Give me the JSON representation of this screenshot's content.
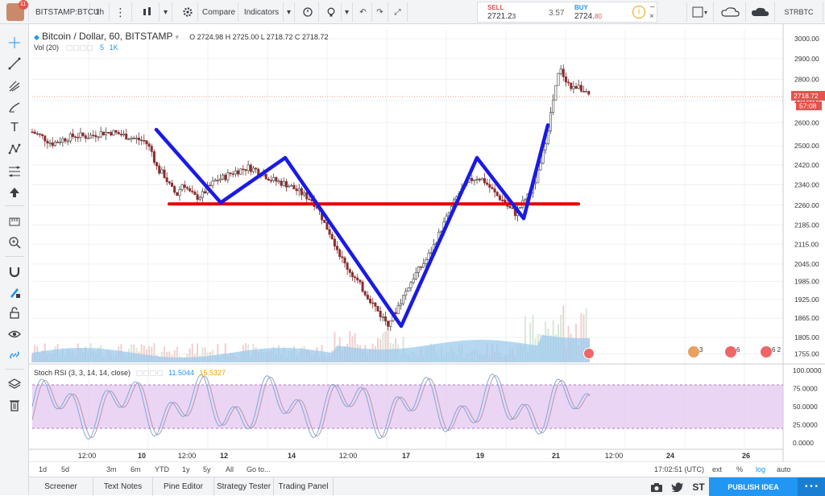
{
  "toolbar": {
    "symbol": "BITSTAMP:BTCU",
    "interval": "1h",
    "compare": "Compare",
    "indicators": "Indicators",
    "sell_label": "SELL",
    "sell_price_main": "2721.2",
    "sell_price_small": "3",
    "spread": "3.57",
    "buy_label": "BUY",
    "buy_price_main": "2724.",
    "buy_price_small": "80",
    "layout_name": "STRBTC"
  },
  "legend": {
    "title": "Bitcoin / Dollar, 60, BITSTAMP",
    "ohlc": "O 2724.98  H 2725.00  L 2718.72  C 2718.72",
    "vol_label": "Vol (20)",
    "vol_value_a": "5",
    "vol_value_b": "1K",
    "rsi_label": "Stoch RSI (3, 3, 14, 14, close)",
    "rsi_k": "11.5044",
    "rsi_d": "15.5327"
  },
  "price_axis": {
    "ticks": [
      "3000.00",
      "2900.00",
      "2800.00",
      "2700.00",
      "2600.00",
      "2500.00",
      "2420.00",
      "2340.00",
      "2260.00",
      "2185.00",
      "2115.00",
      "2045.00",
      "1985.00",
      "1925.00",
      "1865.00",
      "1805.00",
      "1755.00"
    ],
    "last_price": "2718.72",
    "countdown": "57:08"
  },
  "rsi_axis": {
    "ticks": [
      "100.0000",
      "75.0000",
      "50.0000",
      "25.0000",
      "0.0000"
    ]
  },
  "time_axis": {
    "ticks": [
      "12:00",
      "10",
      "12:00",
      "12",
      "14",
      "12:00",
      "17",
      "19",
      "21",
      "12:00",
      "24",
      "26"
    ]
  },
  "range_bar": {
    "buttons": [
      "1d",
      "5d",
      "3m",
      "6m",
      "YTD",
      "1y",
      "5y",
      "All",
      "Go to..."
    ],
    "clock": "17:02:51 (UTC)",
    "options": [
      "ext",
      "%",
      "log",
      "auto"
    ]
  },
  "flags": [
    "3",
    "6",
    "6 2"
  ],
  "bottom_tabs": [
    "Screener",
    "Text Notes",
    "Pine Editor",
    "Strategy Tester",
    "Trading Panel"
  ],
  "bottom_right": {
    "st": "ST",
    "publish": "PUBLISH IDEA"
  },
  "chart_data": {
    "type": "candlestick",
    "title": "Bitcoin / Dollar, 60, BITSTAMP",
    "y_axis_scale": "log",
    "ylim": [
      1730,
      3050
    ],
    "close_path": [
      [
        0,
        2560
      ],
      [
        12,
        2540
      ],
      [
        25,
        2510
      ],
      [
        40,
        2530
      ],
      [
        55,
        2545
      ],
      [
        70,
        2540
      ],
      [
        85,
        2555
      ],
      [
        100,
        2560
      ],
      [
        115,
        2545
      ],
      [
        130,
        2530
      ],
      [
        142,
        2520
      ],
      [
        150,
        2480
      ],
      [
        158,
        2400
      ],
      [
        166,
        2380
      ],
      [
        174,
        2330
      ],
      [
        182,
        2300
      ],
      [
        190,
        2350
      ],
      [
        198,
        2310
      ],
      [
        206,
        2290
      ],
      [
        214,
        2300
      ],
      [
        222,
        2330
      ],
      [
        232,
        2360
      ],
      [
        242,
        2370
      ],
      [
        252,
        2390
      ],
      [
        262,
        2400
      ],
      [
        272,
        2410
      ],
      [
        282,
        2400
      ],
      [
        292,
        2380
      ],
      [
        302,
        2360
      ],
      [
        312,
        2350
      ],
      [
        322,
        2340
      ],
      [
        332,
        2320
      ],
      [
        342,
        2300
      ],
      [
        352,
        2280
      ],
      [
        360,
        2250
      ],
      [
        368,
        2190
      ],
      [
        376,
        2150
      ],
      [
        384,
        2100
      ],
      [
        392,
        2050
      ],
      [
        400,
        2020
      ],
      [
        408,
        1990
      ],
      [
        416,
        1960
      ],
      [
        424,
        1930
      ],
      [
        432,
        1900
      ],
      [
        440,
        1870
      ],
      [
        448,
        1850
      ],
      [
        456,
        1880
      ],
      [
        464,
        1920
      ],
      [
        472,
        1960
      ],
      [
        480,
        2000
      ],
      [
        488,
        2030
      ],
      [
        496,
        2060
      ],
      [
        504,
        2100
      ],
      [
        512,
        2150
      ],
      [
        520,
        2200
      ],
      [
        528,
        2250
      ],
      [
        536,
        2300
      ],
      [
        544,
        2330
      ],
      [
        552,
        2360
      ],
      [
        560,
        2370
      ],
      [
        568,
        2360
      ],
      [
        576,
        2330
      ],
      [
        584,
        2300
      ],
      [
        592,
        2280
      ],
      [
        600,
        2250
      ],
      [
        608,
        2230
      ],
      [
        616,
        2260
      ],
      [
        624,
        2300
      ],
      [
        632,
        2340
      ],
      [
        640,
        2420
      ],
      [
        648,
        2550
      ],
      [
        656,
        2700
      ],
      [
        664,
        2850
      ],
      [
        672,
        2800
      ],
      [
        680,
        2750
      ],
      [
        688,
        2780
      ],
      [
        696,
        2730
      ],
      [
        702,
        2719
      ]
    ],
    "annotations": [
      {
        "type": "horizontal-line",
        "color": "#e60000",
        "value": 2265,
        "x_range": [
          174,
          682
        ]
      },
      {
        "type": "polyline",
        "color": "#1a1ae6",
        "points": [
          [
            158,
            2570
          ],
          [
            238,
            2270
          ],
          [
            318,
            2450
          ],
          [
            462,
            1840
          ],
          [
            556,
            2450
          ],
          [
            614,
            2210
          ],
          [
            644,
            2590
          ]
        ]
      }
    ]
  },
  "colors": {
    "up_candle": "#3d3d3d",
    "down_candle": "#8a2e2e",
    "volume": "#9cc9ec",
    "rsi_band": "#e3c3f0",
    "accent": "#2196f3",
    "sell": "#d9534f",
    "buy": "#2196f3",
    "price_tag": "#e5534b"
  }
}
